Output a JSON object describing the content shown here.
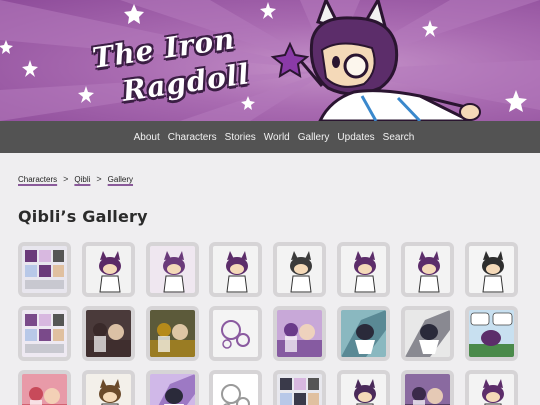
{
  "site": {
    "logo_line1": "The Iron",
    "logo_line2": "Ragdoll"
  },
  "nav": {
    "items": [
      "About",
      "Characters",
      "Stories",
      "World",
      "Gallery",
      "Updates",
      "Search"
    ]
  },
  "breadcrumb": {
    "items": [
      "Characters",
      "Qibli",
      "Gallery"
    ],
    "separator": ">"
  },
  "page": {
    "title": "Qibli’s Gallery"
  },
  "gallery": {
    "rows": 3,
    "columns": 8,
    "thumbs": [
      {
        "palette": "multi",
        "fg": "#6b3a7a",
        "bg": "#e8e6ee"
      },
      {
        "palette": "char",
        "fg": "#5b2a66",
        "bg": "#f2f2f2"
      },
      {
        "palette": "char",
        "fg": "#6a3a7a",
        "bg": "#efe7f0"
      },
      {
        "palette": "char",
        "fg": "#5c2d6a",
        "bg": "#f3f3f3"
      },
      {
        "palette": "char",
        "fg": "#3b3b3b",
        "bg": "#f3f3f3"
      },
      {
        "palette": "char",
        "fg": "#5c2d6a",
        "bg": "#f3f3f3"
      },
      {
        "palette": "char",
        "fg": "#5c2d6a",
        "bg": "#f3f3f3"
      },
      {
        "palette": "char",
        "fg": "#2e2e2e",
        "bg": "#f5f5f5"
      },
      {
        "palette": "multi",
        "fg": "#7a4a8a",
        "bg": "#eee9f2"
      },
      {
        "palette": "scene",
        "fg": "#3a2a2a",
        "bg": "#4a3a3a"
      },
      {
        "palette": "scene",
        "fg": "#b58a1a",
        "bg": "#5c5a3a"
      },
      {
        "palette": "sketch",
        "fg": "#8a5aa0",
        "bg": "#f4f4f4"
      },
      {
        "palette": "scene",
        "fg": "#6a3a8a",
        "bg": "#c8a8d8"
      },
      {
        "palette": "action",
        "fg": "#2a5a6a",
        "bg": "#8ab8c0"
      },
      {
        "palette": "action",
        "fg": "#2a2a3a",
        "bg": "#e8e8e8"
      },
      {
        "palette": "comic",
        "fg": "#4a8a4a",
        "bg": "#c8e0f0"
      },
      {
        "palette": "scene",
        "fg": "#c84a5a",
        "bg": "#e89aa8"
      },
      {
        "palette": "char",
        "fg": "#6a4a2a",
        "bg": "#f3f0ea"
      },
      {
        "palette": "action",
        "fg": "#6a3aa0",
        "bg": "#d0b8e8"
      },
      {
        "palette": "sketch",
        "fg": "#9a9a9a",
        "bg": "#ffffff"
      },
      {
        "palette": "multi",
        "fg": "#3a3a4a",
        "bg": "#e8e8ee"
      },
      {
        "palette": "char",
        "fg": "#4a2a5a",
        "bg": "#f3f3f3"
      },
      {
        "palette": "scene",
        "fg": "#3a2a4a",
        "bg": "#8a6aa0"
      },
      {
        "palette": "char",
        "fg": "#5c2d6a",
        "bg": "#f3f3f3"
      }
    ]
  },
  "colors": {
    "banner_purple": "#a96bb1",
    "nav_bg": "#535353",
    "page_bg": "#efeef0",
    "accent": "#8a5a9a"
  }
}
